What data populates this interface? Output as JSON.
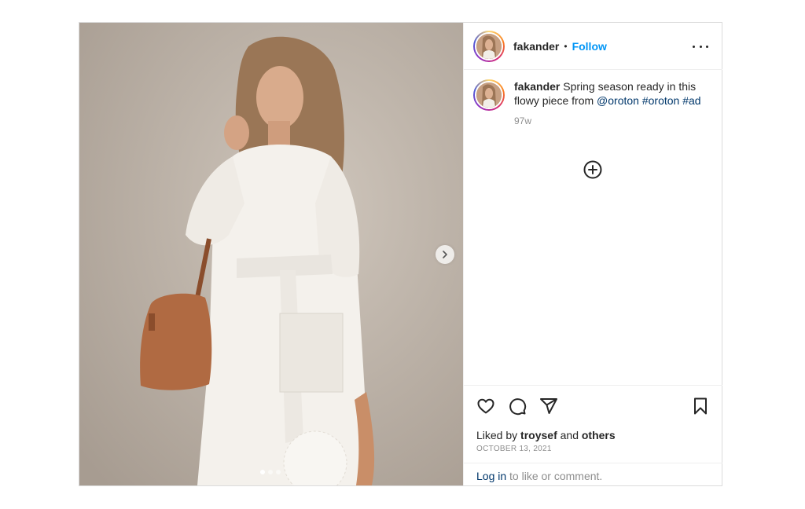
{
  "post": {
    "username": "fakander",
    "separator": "•",
    "follow_label": "Follow",
    "caption": {
      "username": "fakander",
      "text": " Spring season ready in this flowy piece from ",
      "mention": "@oroton",
      "hashtag1": "#oroton",
      "hashtag2": "#ad",
      "age": "97w"
    },
    "likes": {
      "prefix": "Liked by ",
      "user": "troysef",
      "middle": " and ",
      "others": "others"
    },
    "date": "October 13, 2021",
    "login": {
      "link": "Log in",
      "text": " to like or comment."
    },
    "carousel": {
      "slides": 3,
      "active": 1
    }
  },
  "icons": {
    "more": "more-options-icon",
    "add_comment": "plus-circle-icon",
    "like": "heart-icon",
    "comment": "comment-icon",
    "share": "share-icon",
    "save": "bookmark-icon",
    "next": "chevron-right-icon"
  },
  "colors": {
    "follow": "#0095f6",
    "link": "#00376b",
    "muted": "#8e8e8e",
    "border": "#dbdbdb"
  }
}
